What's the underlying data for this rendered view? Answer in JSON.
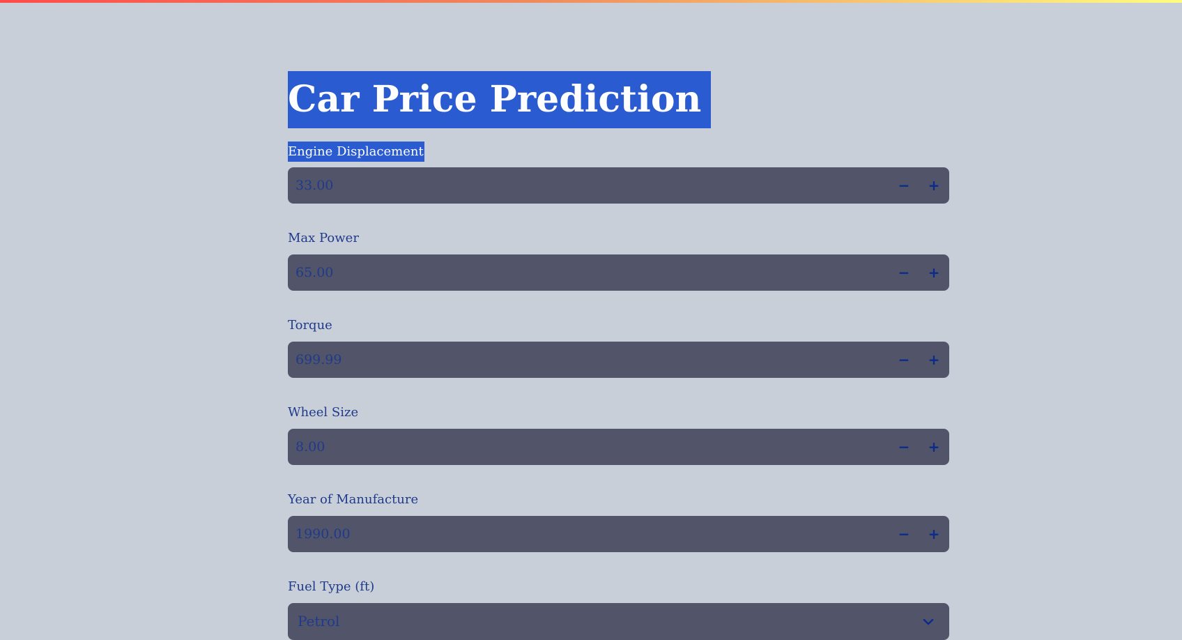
{
  "app": {
    "title": "Car Price Prediction"
  },
  "fields": [
    {
      "label": "Engine Displacement",
      "value": "33.00",
      "minus": "−",
      "plus": "+"
    },
    {
      "label": "Max Power",
      "value": "65.00",
      "minus": "−",
      "plus": "+"
    },
    {
      "label": "Torque",
      "value": "699.99",
      "minus": "−",
      "plus": "+"
    },
    {
      "label": "Wheel Size",
      "value": "8.00",
      "minus": "−",
      "plus": "+"
    },
    {
      "label": "Year of Manufacture",
      "value": "1990.00",
      "minus": "−",
      "plus": "+"
    }
  ],
  "fuel": {
    "label": "Fuel Type (ft)",
    "selected": "Petrol"
  },
  "icons": {
    "dropdown": "chevron-down-icon"
  },
  "colors": {
    "background": "#c9cfd9",
    "input_background": "#525569",
    "text": "#1f3a8a",
    "selection": "#2a5bd1"
  }
}
